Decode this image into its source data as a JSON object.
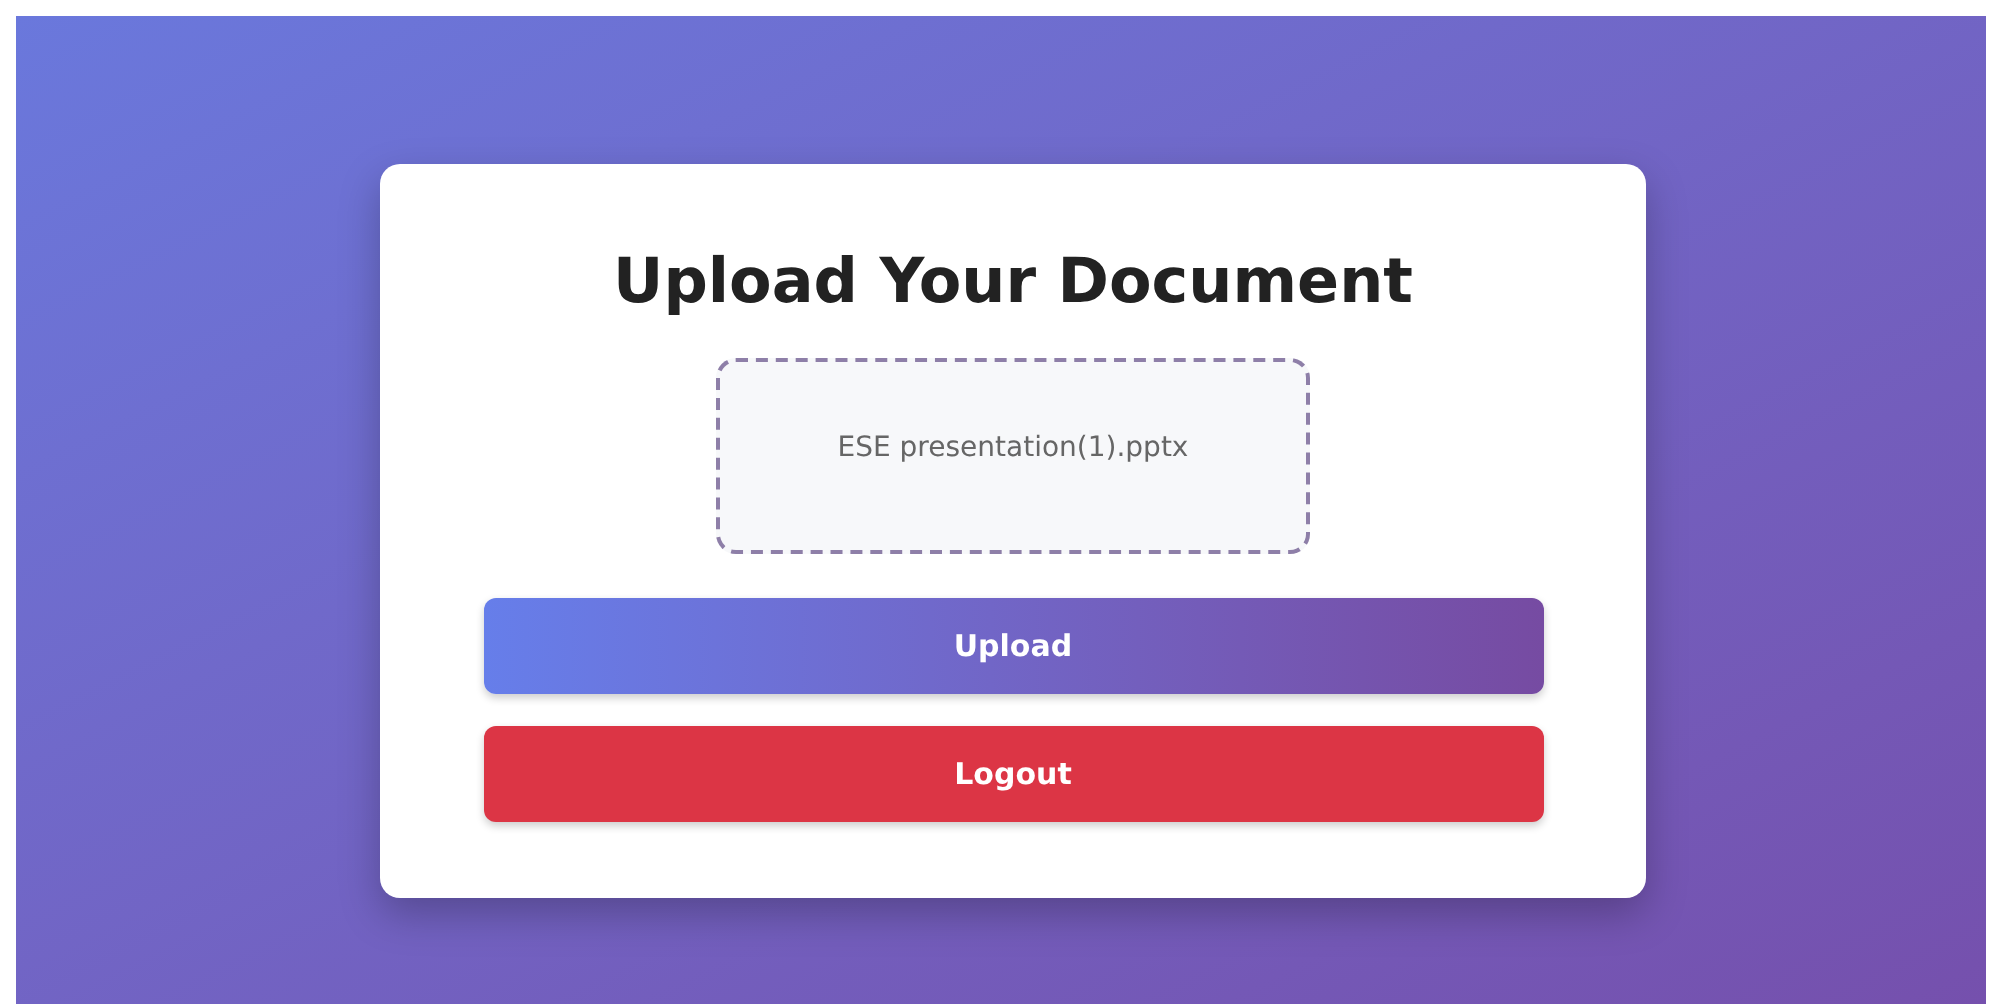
{
  "title": "Upload Your Document",
  "dropzone": {
    "file_name": "ESE presentation(1).pptx"
  },
  "buttons": [
    {
      "label": "Upload",
      "kind": "primary"
    },
    {
      "label": "Logout",
      "kind": "danger"
    }
  ]
}
